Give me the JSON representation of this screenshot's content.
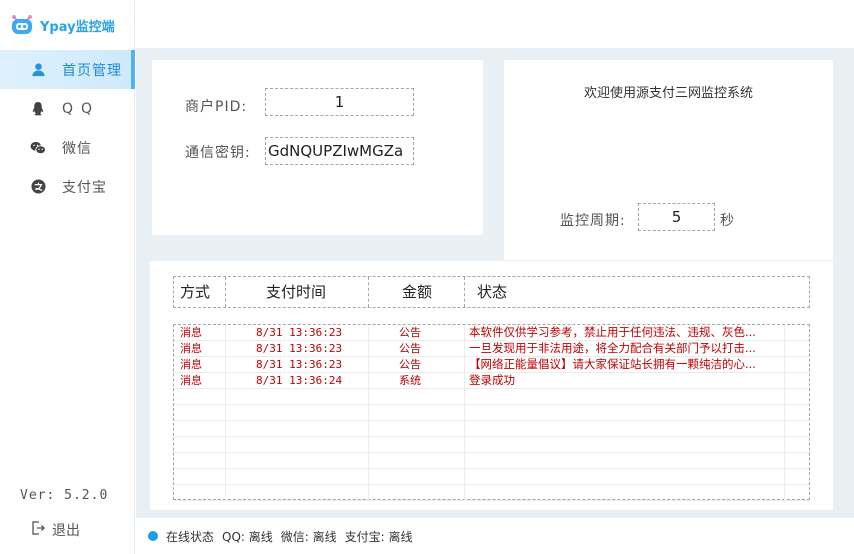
{
  "app": {
    "title": "Ypay监控端",
    "accent": "#2aa3e8"
  },
  "sidebar": {
    "items": [
      {
        "label": "首页管理",
        "icon": "user-icon",
        "active": true
      },
      {
        "label": "QQ",
        "icon": "qq-penguin-icon",
        "active": false
      },
      {
        "label": "微信",
        "icon": "wechat-icon",
        "active": false
      },
      {
        "label": "支付宝",
        "icon": "alipay-icon",
        "active": false
      }
    ],
    "version": "Ver: 5.2.0",
    "logout": "退出"
  },
  "config": {
    "pid_label": "商户PID:",
    "pid_value": "1",
    "key_label": "通信密钥:",
    "key_value": "GdNQUPZIwMGZa",
    "welcome": "欢迎使用源支付三网监控系统",
    "period_label": "监控周期:",
    "period_value": "5",
    "period_unit": "秒"
  },
  "table": {
    "headers": [
      "方式",
      "支付时间",
      "金额",
      "状态"
    ],
    "rows": [
      {
        "type": "消息",
        "time": "8/31 13:36:23",
        "amount": "公告",
        "status": "本软件仅供学习参考，禁止用于任何违法、违规、灰色..."
      },
      {
        "type": "消息",
        "time": "8/31 13:36:23",
        "amount": "公告",
        "status": "一旦发现用于非法用途，将全力配合有关部门予以打击..."
      },
      {
        "type": "消息",
        "time": "8/31 13:36:23",
        "amount": "公告",
        "status": "【网络正能量倡议】请大家保证站长拥有一颗纯洁的心..."
      },
      {
        "type": "消息",
        "time": "8/31 13:36:24",
        "amount": "系统",
        "status": "登录成功"
      }
    ]
  },
  "status_bar": {
    "online": "在线状态",
    "qq": "QQ: 离线",
    "wechat": "微信: 离线",
    "alipay": "支付宝: 离线"
  }
}
